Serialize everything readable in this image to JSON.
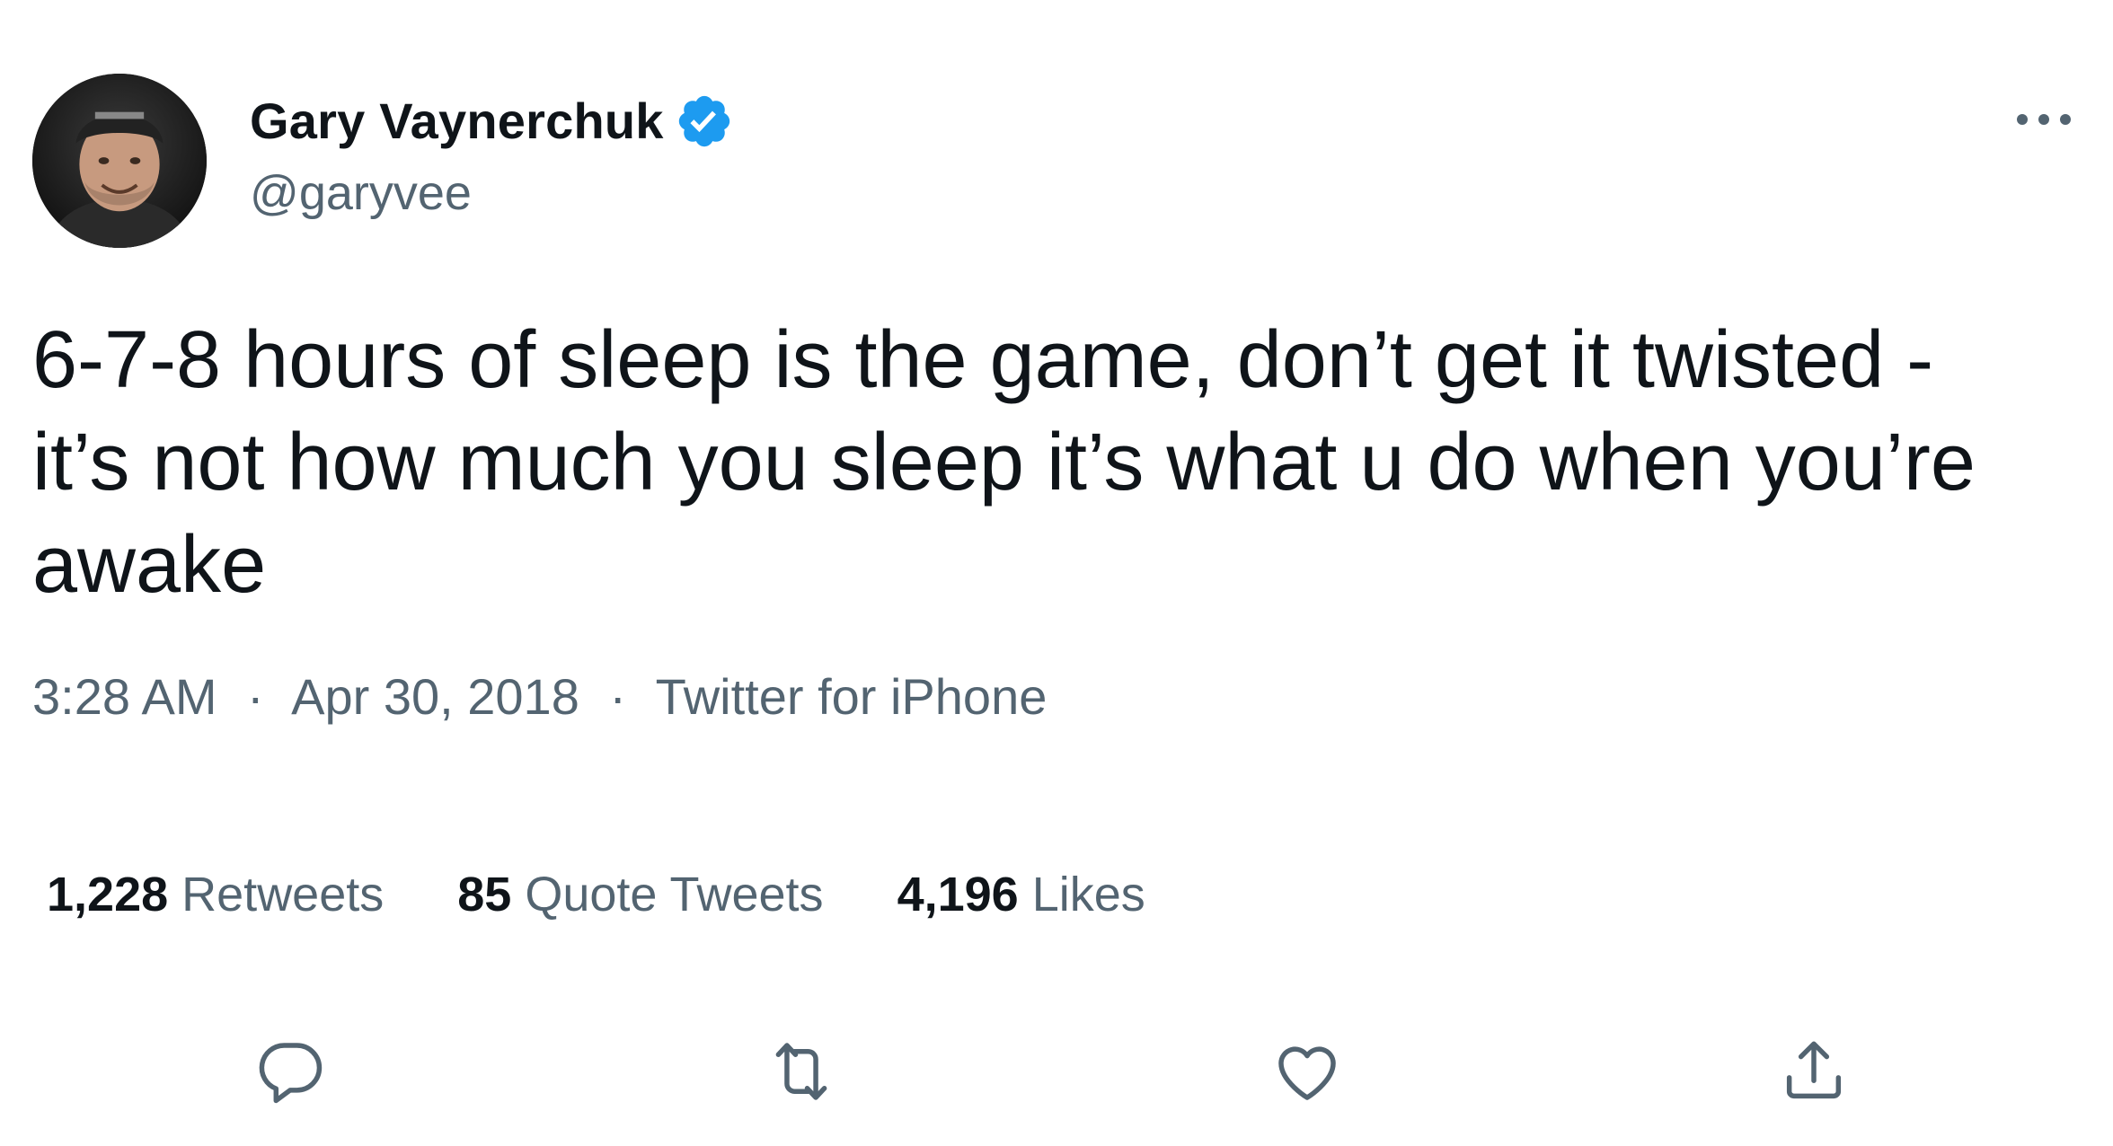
{
  "author": {
    "name": "Gary Vaynerchuk",
    "handle": "@garyvee",
    "verified_icon": "verified-badge-icon",
    "avatar_icon": "avatar-photo"
  },
  "menu": {
    "icon": "more-horizontal-icon"
  },
  "tweet": {
    "text": "6-7-8 hours of sleep is the game, don’t get it twisted -\nit’s not how much you sleep it’s what u do when you’re\nawake",
    "time": "3:28 AM",
    "separator": "·",
    "date": "Apr 30, 2018",
    "source": "Twitter for iPhone"
  },
  "stats": {
    "retweets_count": "1,228",
    "retweets_label": "Retweets",
    "quotes_count": "85",
    "quotes_label": "Quote Tweets",
    "likes_count": "4,196",
    "likes_label": "Likes"
  },
  "actions": [
    "reply-icon",
    "retweet-icon",
    "like-icon",
    "share-icon"
  ],
  "colors": {
    "text_primary": "#0f1419",
    "text_secondary": "#536471",
    "verified_blue": "#1d9bf0",
    "background": "#ffffff"
  }
}
